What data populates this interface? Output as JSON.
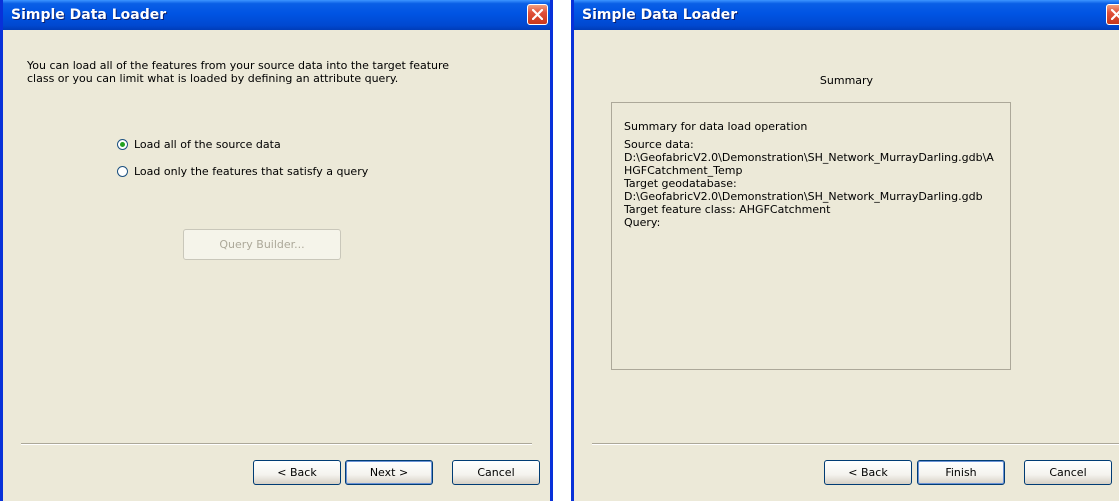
{
  "left_window": {
    "title": "Simple Data Loader",
    "intro_text": "You can load all of the features from your source data into the target feature class or you can limit what is loaded by defining an attribute query.",
    "options": [
      {
        "label": "Load all of the source data",
        "checked": true
      },
      {
        "label": "Load only the features that satisfy a query",
        "checked": false
      }
    ],
    "query_builder_label": "Query Builder...",
    "buttons": {
      "back": "< Back",
      "next": "Next >",
      "cancel": "Cancel"
    }
  },
  "right_window": {
    "title": "Simple Data Loader",
    "heading": "Summary",
    "summary_lines": [
      "Summary for data load operation",
      "Source data:",
      "D:\\GeofabricV2.0\\Demonstration\\SH_Network_MurrayDarling.gdb\\A",
      "HGFCatchment_Temp",
      "Target geodatabase:",
      "D:\\GeofabricV2.0\\Demonstration\\SH_Network_MurrayDarling.gdb",
      "Target feature class: AHGFCatchment",
      "Query:"
    ],
    "buttons": {
      "back": "< Back",
      "finish": "Finish",
      "cancel": "Cancel"
    }
  },
  "colors": {
    "title_bar": "#0054e3",
    "dialog_background": "#ece9d8",
    "close_button": "#e0503a",
    "radio_checked_dot": "#21a121"
  }
}
